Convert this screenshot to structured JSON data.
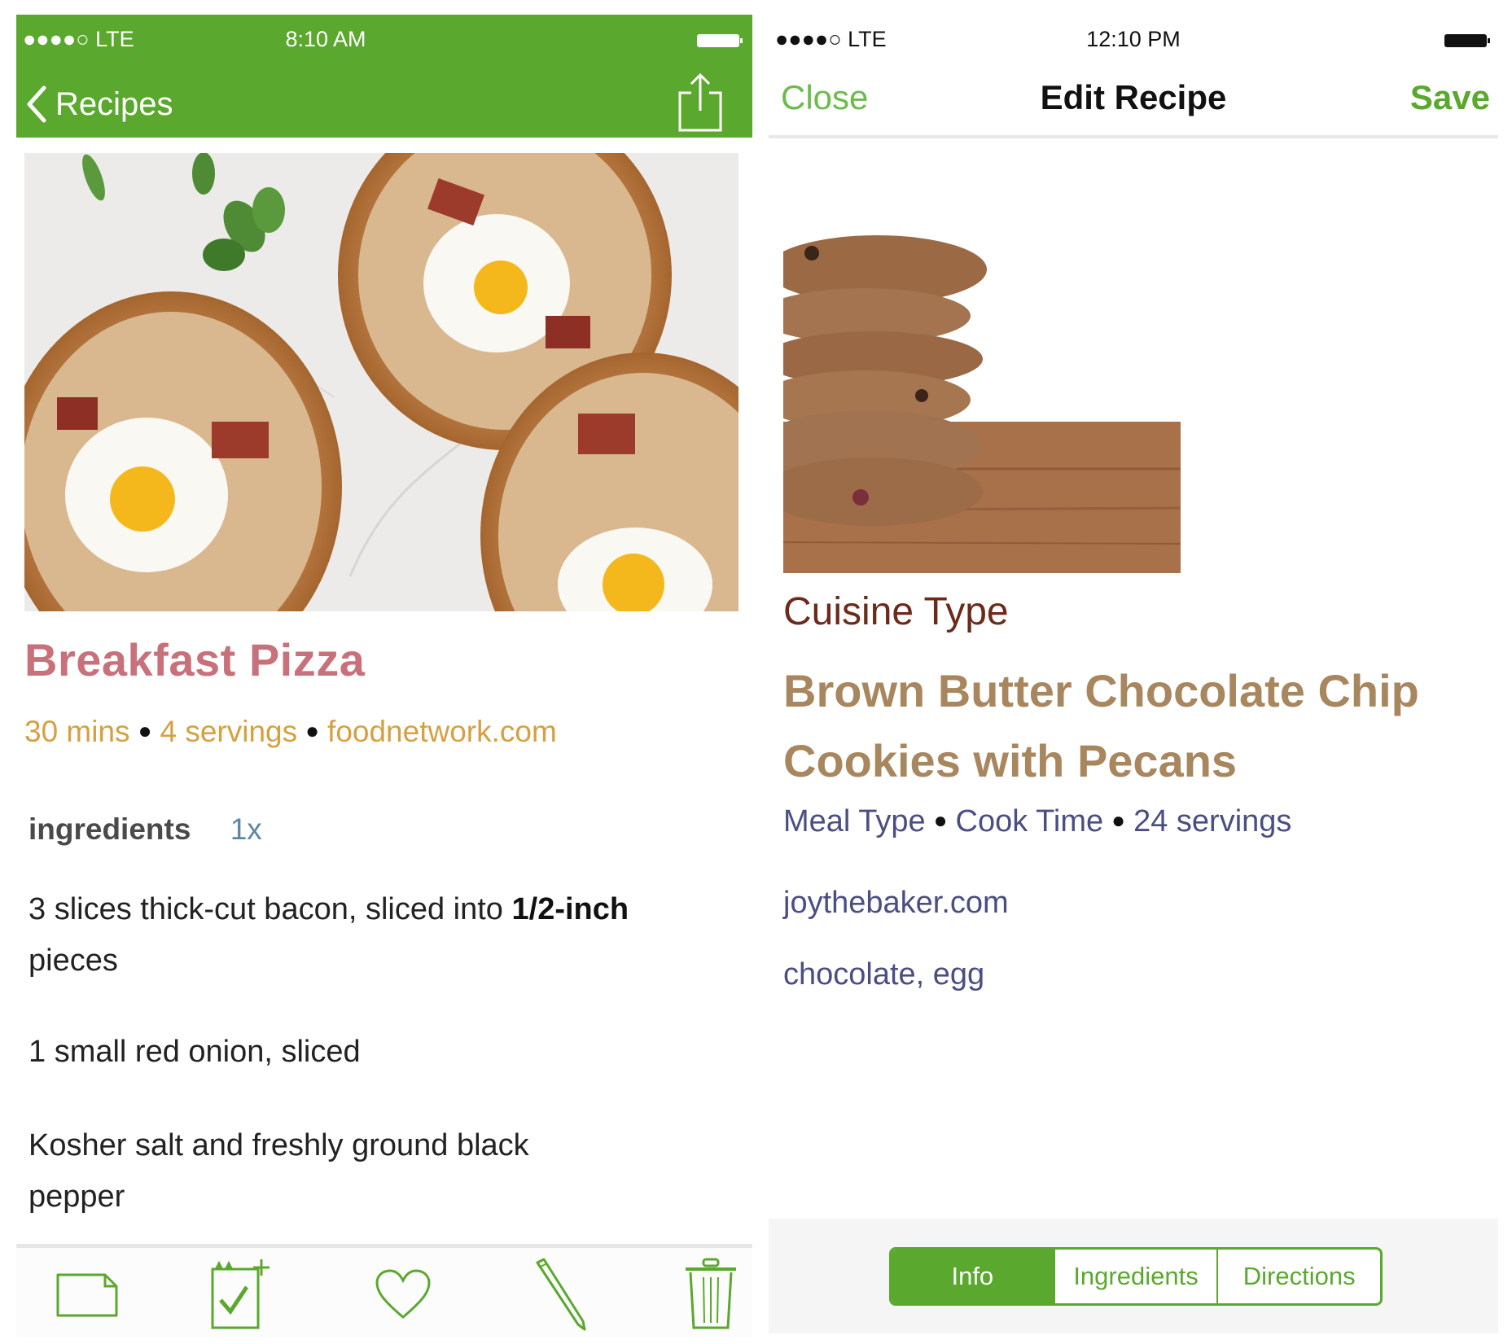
{
  "colors": {
    "accent_green": "#5aa82e",
    "recipe_title": "#c8717a",
    "meta_gold": "#d6a040",
    "cuisine_brown": "#6b2a1a",
    "cookie_title": "#a8875f",
    "meta_slate": "#4a4e82"
  },
  "left_screen": {
    "status_bar": {
      "signal": "●●●●○",
      "carrier": "LTE",
      "time": "8:10 AM",
      "battery_icon": "battery-icon"
    },
    "nav": {
      "back_label": "Recipes",
      "share_icon": "share-icon"
    },
    "recipe": {
      "image_alt": "Breakfast pizzas with fried eggs, bacon and basil on marble",
      "title": "Breakfast Pizza",
      "meta": {
        "time": "30 mins",
        "servings": "4 servings",
        "source": "foodnetwork.com",
        "separator": "●"
      },
      "ingredients_label": "ingredients",
      "scale": "1x",
      "ingredients": [
        {
          "pre": "3 slices thick-cut bacon, sliced into ",
          "bold": "1/2-inch",
          "post": " pieces"
        },
        {
          "pre": "1 small red onion, sliced",
          "bold": "",
          "post": ""
        },
        {
          "pre": "Kosher salt and freshly ground black pepper",
          "bold": "",
          "post": ""
        }
      ]
    },
    "toolbar": [
      {
        "name": "folder-icon",
        "label": "Folder"
      },
      {
        "name": "add-to-list-icon",
        "label": "Add to list"
      },
      {
        "name": "heart-icon",
        "label": "Favorite"
      },
      {
        "name": "pencil-icon",
        "label": "Edit"
      },
      {
        "name": "trash-icon",
        "label": "Delete"
      }
    ]
  },
  "right_screen": {
    "status_bar": {
      "signal": "●●●●○",
      "carrier": "LTE",
      "time": "12:10 PM",
      "battery_icon": "battery-icon"
    },
    "nav": {
      "close_label": "Close",
      "title": "Edit Recipe",
      "save_label": "Save"
    },
    "recipe": {
      "image_alt": "Stack of chocolate chip cookies on wooden table",
      "cuisine_placeholder": "Cuisine Type",
      "title": "Brown Butter Chocolate Chip Cookies with Pecans",
      "meta": {
        "meal_type": "Meal Type",
        "cook_time": "Cook Time",
        "servings": "24 servings",
        "separator": "●"
      },
      "source": "joythebaker.com",
      "tags": "chocolate, egg"
    },
    "segments": [
      {
        "label": "Info",
        "active": true
      },
      {
        "label": "Ingredients",
        "active": false
      },
      {
        "label": "Directions",
        "active": false
      }
    ]
  }
}
